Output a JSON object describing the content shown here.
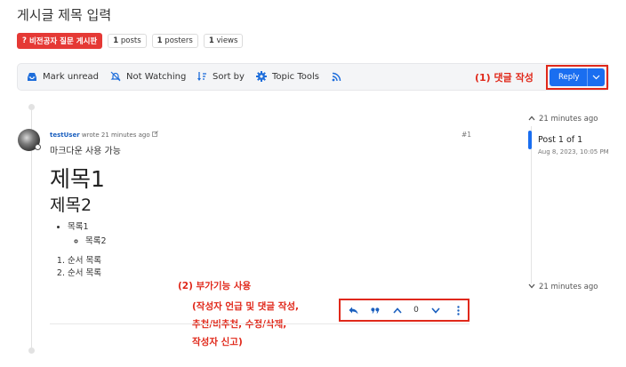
{
  "topic": {
    "title": "게시글 제목 입력",
    "category": "비전공자 질문 게시판",
    "stats": {
      "posts_count": "1",
      "posts_label": "posts",
      "posters_count": "1",
      "posters_label": "posters",
      "views_count": "1",
      "views_label": "views"
    }
  },
  "toolbar": {
    "mark_unread": "Mark unread",
    "watching": "Not Watching",
    "sort_by": "Sort by",
    "topic_tools": "Topic Tools"
  },
  "reply": {
    "label": "Reply"
  },
  "annotations": {
    "reply_note": "(1) 댓글 작성",
    "features_title": "(2) 부가기능 사용",
    "features_line1": "(작성자 언급 및 댓글 작성,",
    "features_line2": "추천/비추천, 수정/삭제,",
    "features_line3": "작성자 신고)"
  },
  "post": {
    "username": "testUser",
    "wrote_time": "wrote 21 minutes ago",
    "number": "#1",
    "content": {
      "line": "마크다운 사용 가능",
      "h1": "제목1",
      "h2": "제목2",
      "list_item": "목록1",
      "sub_item": "목록2",
      "ordered": [
        "순서 목록",
        "순서 목록"
      ]
    },
    "vote_count": "0"
  },
  "timeline": {
    "top_time": "21 minutes ago",
    "position": "Post 1 of 1",
    "date": "Aug 8, 2023, 10:05 PM",
    "bottom_time": "21 minutes ago"
  },
  "colors": {
    "accent": "#1a6ef0",
    "annotation": "#e0281a",
    "category_badge": "#e53935"
  }
}
